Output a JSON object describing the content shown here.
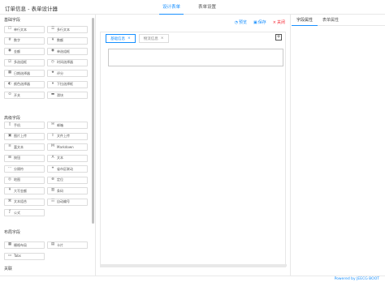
{
  "app": {
    "title": "订单信息 - 表单设计器"
  },
  "top_tabs": [
    {
      "label": "设计表单",
      "active": true
    },
    {
      "label": "表单设置",
      "active": false
    }
  ],
  "toolbar": {
    "preview": "预览",
    "save": "保存",
    "close": "关闭"
  },
  "sidebar": {
    "groups": [
      {
        "title": "基础字段",
        "items": [
          {
            "icon": "☐",
            "label": "单行文本"
          },
          {
            "icon": "☰",
            "label": "多行文本"
          },
          {
            "icon": "#",
            "label": "数字"
          },
          {
            "icon": "¥",
            "label": "数额"
          },
          {
            "icon": "◉",
            "label": "金额"
          },
          {
            "icon": "◉",
            "label": "单选组框"
          },
          {
            "icon": "☑",
            "label": "多选组框"
          },
          {
            "icon": "◷",
            "label": "时间选择器"
          },
          {
            "icon": "▦",
            "label": "日期选择器"
          },
          {
            "icon": "★",
            "label": "评分"
          },
          {
            "icon": "◐",
            "label": "颜色选择器"
          },
          {
            "icon": "▾",
            "label": "下拉选择框"
          },
          {
            "icon": "⊙",
            "label": "开关"
          },
          {
            "icon": "▬",
            "label": "滑块"
          }
        ]
      },
      {
        "title": "高级字段",
        "items": [
          {
            "icon": "▯",
            "label": "手机"
          },
          {
            "icon": "✉",
            "label": "邮箱"
          },
          {
            "icon": "▣",
            "label": "图片上传"
          },
          {
            "icon": "⇪",
            "label": "文件上传"
          },
          {
            "icon": "≡",
            "label": "富文本"
          },
          {
            "icon": "M",
            "label": "Markdown"
          },
          {
            "icon": "⊞",
            "label": "按钮"
          },
          {
            "icon": "A",
            "label": "文本"
          },
          {
            "icon": "⋯",
            "label": "分隔符"
          },
          {
            "icon": "⌖",
            "label": "省市区联动"
          },
          {
            "icon": "◎",
            "label": "地图"
          },
          {
            "icon": "⊕",
            "label": "定位"
          },
          {
            "icon": "¥",
            "label": "大写金额"
          },
          {
            "icon": "▥",
            "label": "条码"
          },
          {
            "icon": "⌘",
            "label": "文本组合"
          },
          {
            "icon": "☷",
            "label": "自动编号"
          },
          {
            "icon": "ƒ",
            "label": "公式"
          }
        ]
      },
      {
        "title": "布局字段",
        "items": [
          {
            "icon": "▦",
            "label": "栅格布局"
          },
          {
            "icon": "▤",
            "label": "卡片"
          },
          {
            "icon": "▭",
            "label": "Tabs"
          }
        ]
      },
      {
        "title": "关联",
        "items": []
      }
    ]
  },
  "canvas": {
    "tabs": [
      {
        "label": "基础信息",
        "active": true
      },
      {
        "label": "物流信息",
        "active": false
      }
    ],
    "close_mark": "×",
    "add_mark": "+"
  },
  "right_panel": {
    "tabs": [
      {
        "label": "字段属性",
        "active": true
      },
      {
        "label": "表单属性",
        "active": false
      }
    ]
  },
  "footer": {
    "text": "Powered by JEECG BOOT"
  },
  "colors": {
    "accent": "#1890ff",
    "danger": "#f5222d",
    "border": "#e8e8e8"
  },
  "icons": {
    "preview": "eye-icon",
    "save": "save-icon",
    "close": "close-icon"
  }
}
